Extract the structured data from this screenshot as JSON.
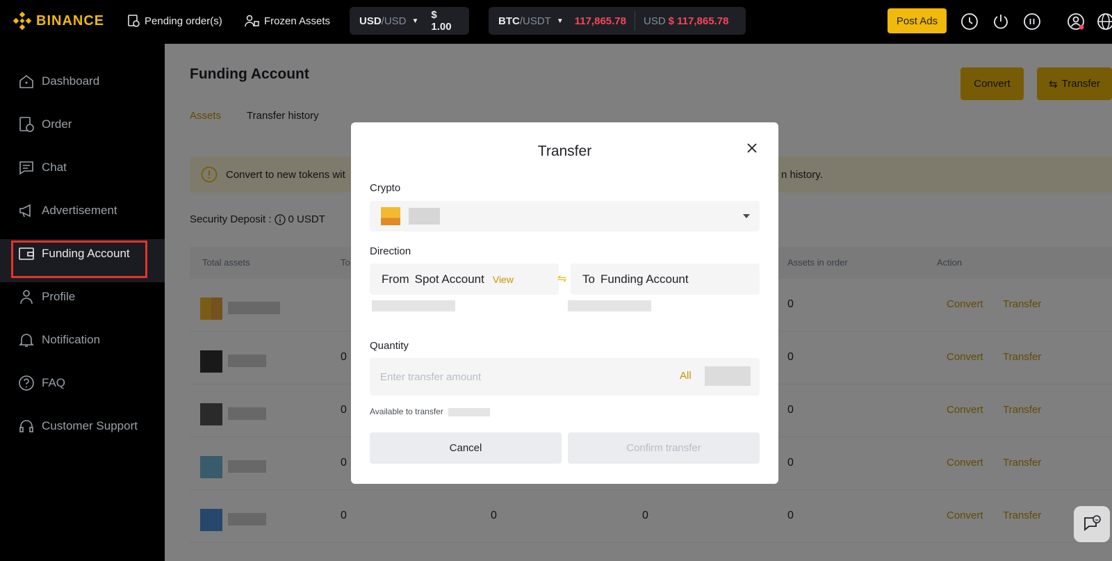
{
  "brand": {
    "name": "BINANCE"
  },
  "topbar": {
    "pending_orders": "Pending order(s)",
    "frozen_assets": "Frozen Assets",
    "ticker1": {
      "base": "USD",
      "quote": "/USD",
      "price": "$ 1.00"
    },
    "ticker2": {
      "base": "BTC",
      "quote": "/USDT",
      "price": "117,865.78",
      "usd_label": "USD",
      "usd_price": "$ 117,865.78"
    },
    "post_ads": "Post Ads"
  },
  "sidebar": {
    "items": [
      {
        "label": "Dashboard",
        "icon": "home-icon"
      },
      {
        "label": "Order",
        "icon": "order-icon"
      },
      {
        "label": "Chat",
        "icon": "chat-icon"
      },
      {
        "label": "Advertisement",
        "icon": "megaphone-icon"
      },
      {
        "label": "Funding Account",
        "icon": "wallet-icon",
        "active": true
      },
      {
        "label": "Profile",
        "icon": "user-icon"
      },
      {
        "label": "Notification",
        "icon": "bell-icon"
      },
      {
        "label": "FAQ",
        "icon": "question-icon"
      },
      {
        "label": "Customer Support",
        "icon": "headset-icon"
      }
    ]
  },
  "main": {
    "title": "Funding Account",
    "convert_button": "Convert",
    "transfer_button": "Transfer",
    "tabs": [
      {
        "label": "Assets",
        "active": true
      },
      {
        "label": "Transfer history"
      }
    ],
    "notice_start": "Convert to new tokens wit",
    "notice_end": "n history.",
    "security_deposit_label": "Security Deposit :",
    "security_deposit_value": "0 USDT",
    "table": {
      "headers": [
        "Total assets",
        "To",
        "Assets in order",
        "Action"
      ],
      "rows": [
        {
          "col1": "",
          "col2": "",
          "col3": "",
          "in_order": "0",
          "convert": "Convert",
          "transfer": "Transfer"
        },
        {
          "col1": "0",
          "col2": "",
          "col3": "",
          "in_order": "0",
          "convert": "Convert",
          "transfer": "Transfer"
        },
        {
          "col1": "0",
          "col2": "",
          "col3": "",
          "in_order": "0",
          "convert": "Convert",
          "transfer": "Transfer"
        },
        {
          "col1": "0",
          "col2": "",
          "col3": "",
          "in_order": "0",
          "convert": "Convert",
          "transfer": "Transfer"
        },
        {
          "col1": "0",
          "col2": "0",
          "col3": "0",
          "in_order": "0",
          "convert": "Convert",
          "transfer": "Transfer"
        }
      ]
    }
  },
  "modal": {
    "title": "Transfer",
    "crypto_label": "Crypto",
    "direction_label": "Direction",
    "from_prefix": "From",
    "from_account": "Spot Account",
    "view_link": "View",
    "to_prefix": "To",
    "to_account": "Funding Account",
    "quantity_label": "Quantity",
    "quantity_placeholder": "Enter transfer amount",
    "all_label": "All",
    "available_label": "Available to transfer",
    "cancel": "Cancel",
    "confirm": "Confirm transfer"
  },
  "colors": {
    "accent": "#f0b90b",
    "danger": "#f6465d",
    "highlight": "#e5332a"
  }
}
